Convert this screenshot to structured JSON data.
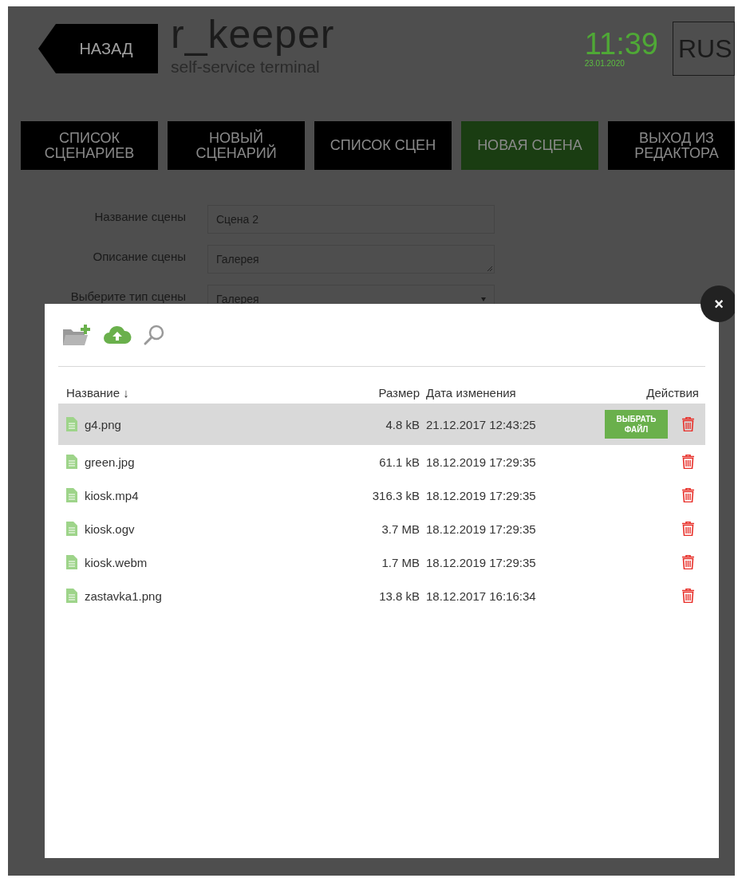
{
  "header": {
    "back_button": "НАЗАД",
    "logo": "r_keeper",
    "logo_subtitle": "self-service terminal",
    "time": "11:39",
    "date": "23.01.2020",
    "language": "RUS"
  },
  "tabs": [
    {
      "label": "СПИСОК\nСЦЕНАРИЕВ",
      "selected": false
    },
    {
      "label": "НОВЫЙ\nСЦЕНАРИЙ",
      "selected": false
    },
    {
      "label": "СПИСОК СЦЕН",
      "selected": false
    },
    {
      "label": "НОВАЯ СЦЕНА",
      "selected": true
    },
    {
      "label": "ВЫХОД ИЗ\nРЕДАКТОРА",
      "selected": false
    }
  ],
  "form": [
    {
      "label": "Название сцены",
      "value": "Сцена 2",
      "kind": "text"
    },
    {
      "label": "Описание сцены",
      "value": "Галерея",
      "kind": "textarea"
    },
    {
      "label": "Выберите тип сцены",
      "value": "Галерея",
      "kind": "select"
    }
  ],
  "file_dialog": {
    "columns": [
      "Название ↓",
      "Размер",
      "Дата изменения",
      "Действия"
    ],
    "rows": [
      {
        "name": "g4.png",
        "size": "4.8 kB",
        "modified": "21.12.2017 12:43:25",
        "selected": true,
        "select_button": "ВЫБРАТЬ\nФАЙЛ"
      },
      {
        "name": "green.jpg",
        "size": "61.1 kB",
        "modified": "18.12.2019 17:29:35",
        "selected": false
      },
      {
        "name": "kiosk.mp4",
        "size": "316.3 kB",
        "modified": "18.12.2019 17:29:35",
        "selected": false
      },
      {
        "name": "kiosk.ogv",
        "size": "3.7 MB",
        "modified": "18.12.2019 17:29:35",
        "selected": false
      },
      {
        "name": "kiosk.webm",
        "size": "1.7 MB",
        "modified": "18.12.2019 17:29:35",
        "selected": false
      },
      {
        "name": "zastavka1.png",
        "size": "13.8 kB",
        "modified": "18.12.2017 16:16:34",
        "selected": false
      }
    ],
    "close_button": "×"
  }
}
